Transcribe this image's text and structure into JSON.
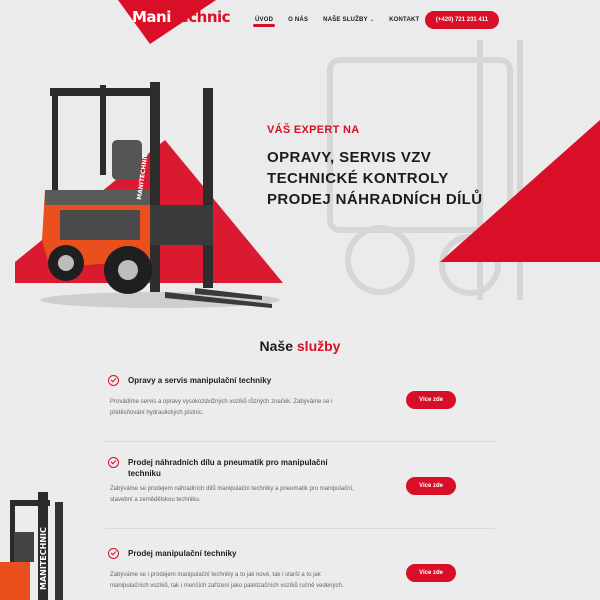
{
  "logo": {
    "part1": "Mani",
    "part2": "Technic"
  },
  "nav": {
    "items": [
      {
        "label": "Úvod"
      },
      {
        "label": "O nás"
      },
      {
        "label": "Naše služby"
      },
      {
        "label": "Kontakt"
      }
    ],
    "chevron": "chevron-down-icon"
  },
  "phone": "(+420) 721 231 411",
  "hero": {
    "subtitle": "VÁŠ EXPERT NA",
    "title_lines": [
      "OPRAVY, SERVIS VZV",
      "TECHNICKÉ KONTROLY",
      "PRODEJ NÁHRADNÍCH DÍLŮ"
    ],
    "forklift_label": "MANITECHNIC"
  },
  "services_title": {
    "part1": "Naše",
    "part2": "služby"
  },
  "services": [
    {
      "title": "Opravy a servis manipulační techniky",
      "desc": "Provádíme servis a opravy vysokozdvižných vozíků různých značek. Zabýváme se i přetěsňování hydraulických pístnic.",
      "button": "Více zde"
    },
    {
      "title": "Prodej náhradních dílu a pneumatik pro manipulační techniku",
      "desc": "Zabýváme se prodejem náhradních dílů manipulační techniky a pneumatik pro manipulační, stavební a zemědělskou techniku.",
      "button": "Více zde"
    },
    {
      "title": "Prodej manipulační techniky",
      "desc": "Zabýváme se i prodejem manipulační techniky a to jak nové, tak i starší a to jak manipulačních vozíků, tak i menších zařízení jako paletizačních vozíků ručně vedených.",
      "button": "Více zde"
    }
  ],
  "colors": {
    "brand": "#d80f26",
    "background": "#ececec",
    "text": "#1c1c1c"
  }
}
